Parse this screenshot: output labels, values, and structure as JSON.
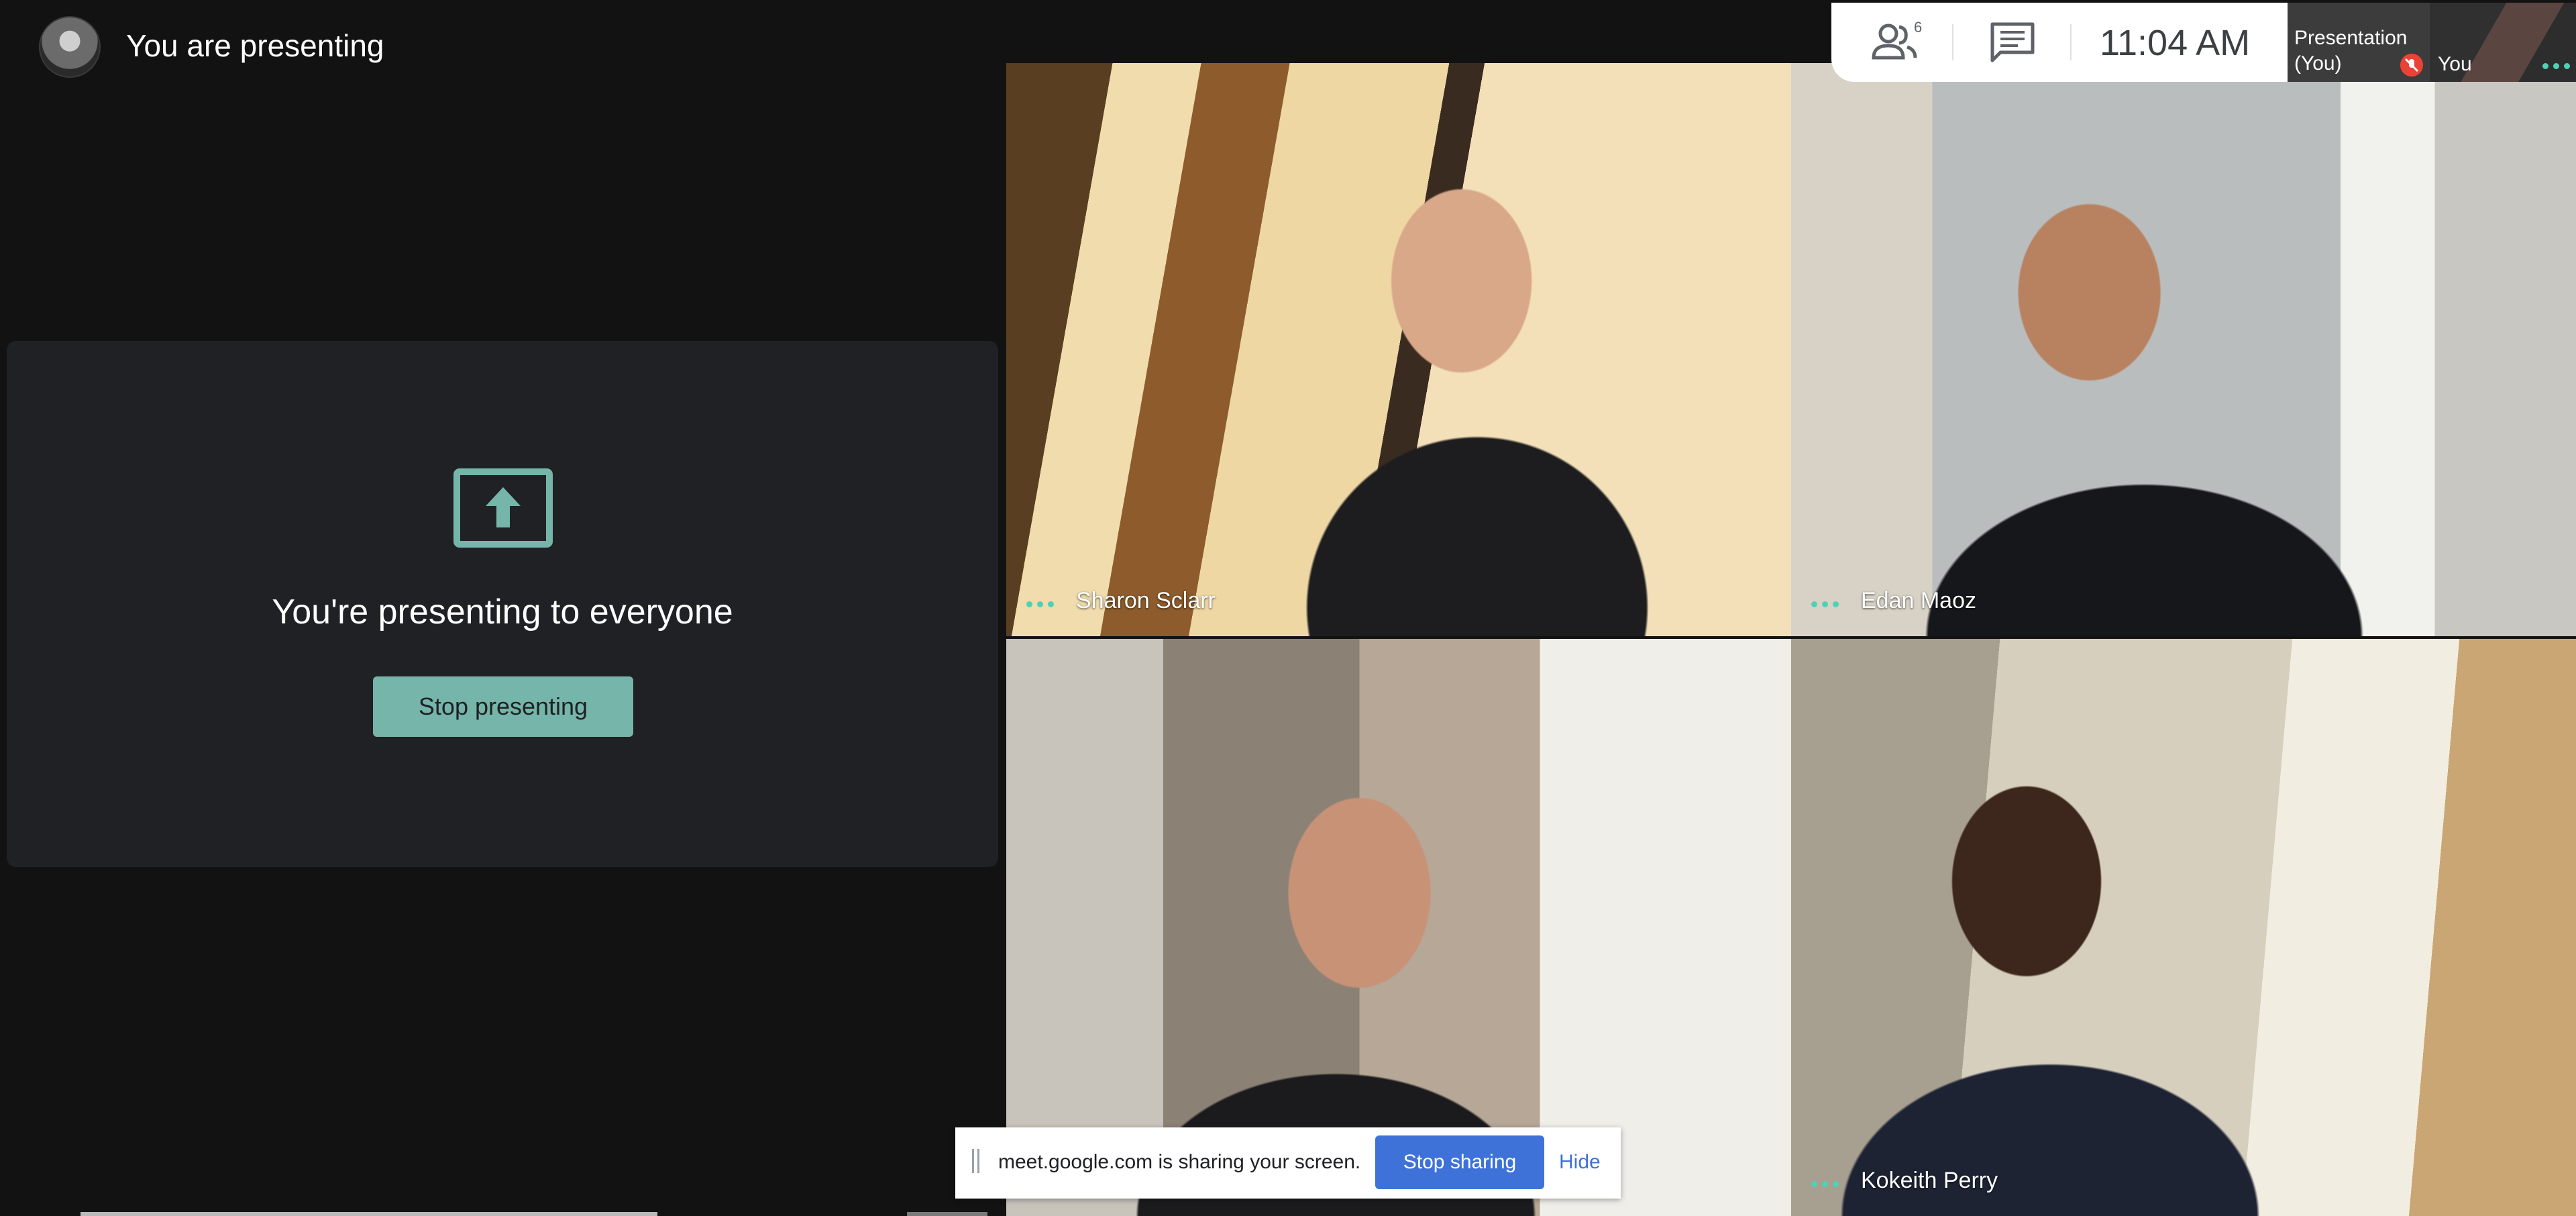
{
  "header": {
    "title": "You are presenting",
    "avatar_icon": "user-avatar"
  },
  "present_panel": {
    "icon": "present-to-all-icon",
    "message": "You're presenting to everyone",
    "stop_button": "Stop presenting",
    "accent": "#75b5aa"
  },
  "participants": [
    {
      "name": "Sharon Sclarr"
    },
    {
      "name": "Edan Maoz"
    },
    {
      "name": ""
    },
    {
      "name": "Kokeith Perry"
    }
  ],
  "top_bar": {
    "people_icon": "people-icon",
    "people_count": "6",
    "chat_icon": "chat-icon",
    "time": "11:04  AM"
  },
  "thumbnails": {
    "presentation_label_1": "Presentation",
    "presentation_label_2": "(You)",
    "mic_off_icon": "mic-off-icon",
    "you_label": "You"
  },
  "share_bar": {
    "text": "meet.google.com is sharing your screen.",
    "stop_button": "Stop sharing",
    "hide_link": "Hide",
    "button_color": "#3f72d8"
  }
}
